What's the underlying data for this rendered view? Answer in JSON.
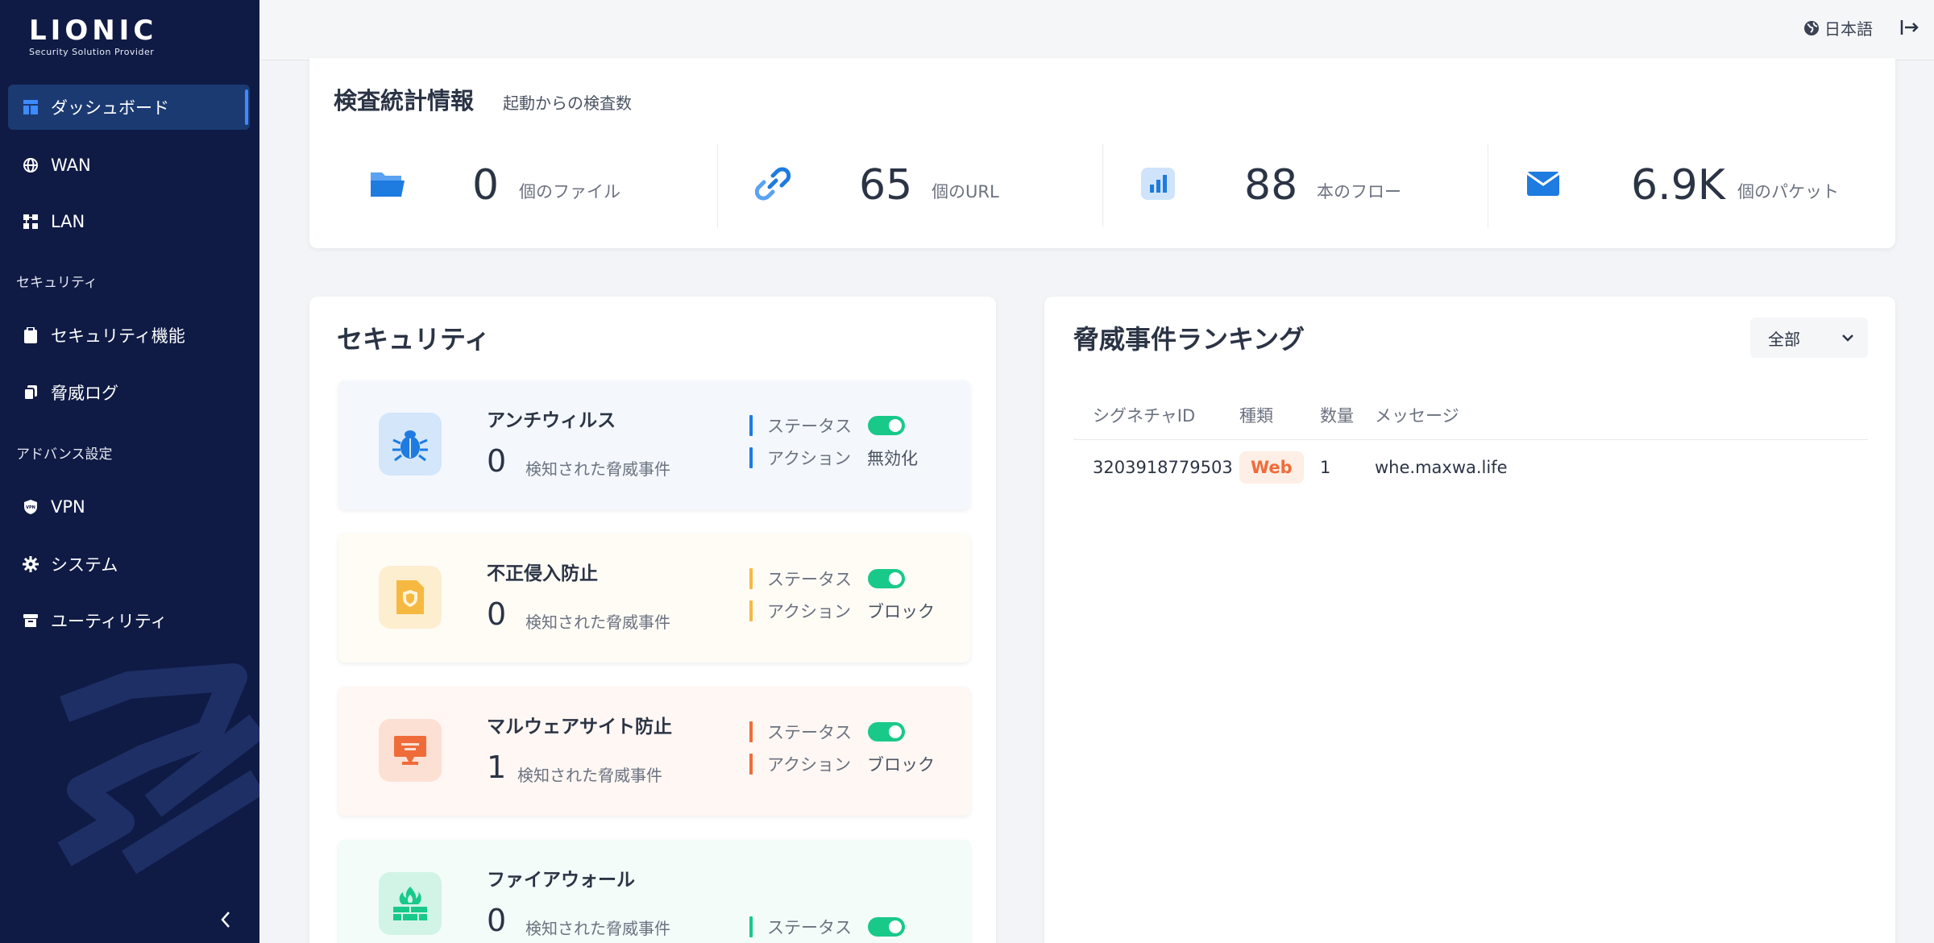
{
  "brand": {
    "name": "LIONIC",
    "tagline": "Security Solution Provider"
  },
  "sidebar": {
    "items": [
      {
        "label": "ダッシュボード",
        "icon": "dashboard-icon"
      },
      {
        "label": "WAN",
        "icon": "globe-icon"
      },
      {
        "label": "LAN",
        "icon": "network-icon"
      },
      {
        "label": "セキュリティ機能",
        "icon": "clipboard-icon"
      },
      {
        "label": "脅威ログ",
        "icon": "copy-icon"
      },
      {
        "label": "VPN",
        "icon": "vpn-shield-icon"
      },
      {
        "label": "システム",
        "icon": "gear-icon"
      },
      {
        "label": "ユーティリティ",
        "icon": "archive-icon"
      }
    ],
    "sections": {
      "security": "セキュリティ",
      "advanced": "アドバンス設定"
    }
  },
  "topbar": {
    "language": "日本語"
  },
  "stats": {
    "title": "検査統計情報",
    "subtitle": "起動からの検査数",
    "items": [
      {
        "value": "0",
        "unit": "個のファイル",
        "icon": "folder-icon"
      },
      {
        "value": "65",
        "unit": "個のURL",
        "icon": "link-icon"
      },
      {
        "value": "88",
        "unit": "本のフロー",
        "icon": "bar-chart-icon"
      },
      {
        "value": "6.9K",
        "unit": "個のパケット",
        "icon": "envelope-icon"
      }
    ]
  },
  "security": {
    "title": "セキュリティ",
    "status_label": "ステータス",
    "action_label": "アクション",
    "detected_label": "検知された脅威事件",
    "features": [
      {
        "name": "アンチウィルス",
        "count": "0",
        "action": "無効化",
        "color": "#1e7be0",
        "icon": "bug-icon"
      },
      {
        "name": "不正侵入防止",
        "count": "0",
        "action": "ブロック",
        "color": "#f5b942",
        "icon": "shield-file-icon"
      },
      {
        "name": "マルウェアサイト防止",
        "count": "1",
        "action": "ブロック",
        "color": "#ef6c3a",
        "icon": "monitor-icon"
      },
      {
        "name": "ファイアウォール",
        "count": "0",
        "action": "",
        "color": "#19c98a",
        "icon": "firewall-icon"
      }
    ]
  },
  "threats": {
    "title": "脅威事件ランキング",
    "filter": "全部",
    "columns": [
      "シグネチャID",
      "種類",
      "数量",
      "メッセージ"
    ],
    "rows": [
      {
        "signature_id": "3203918779503",
        "type": "Web",
        "count": "1",
        "message": "whe.maxwa.life"
      }
    ]
  }
}
